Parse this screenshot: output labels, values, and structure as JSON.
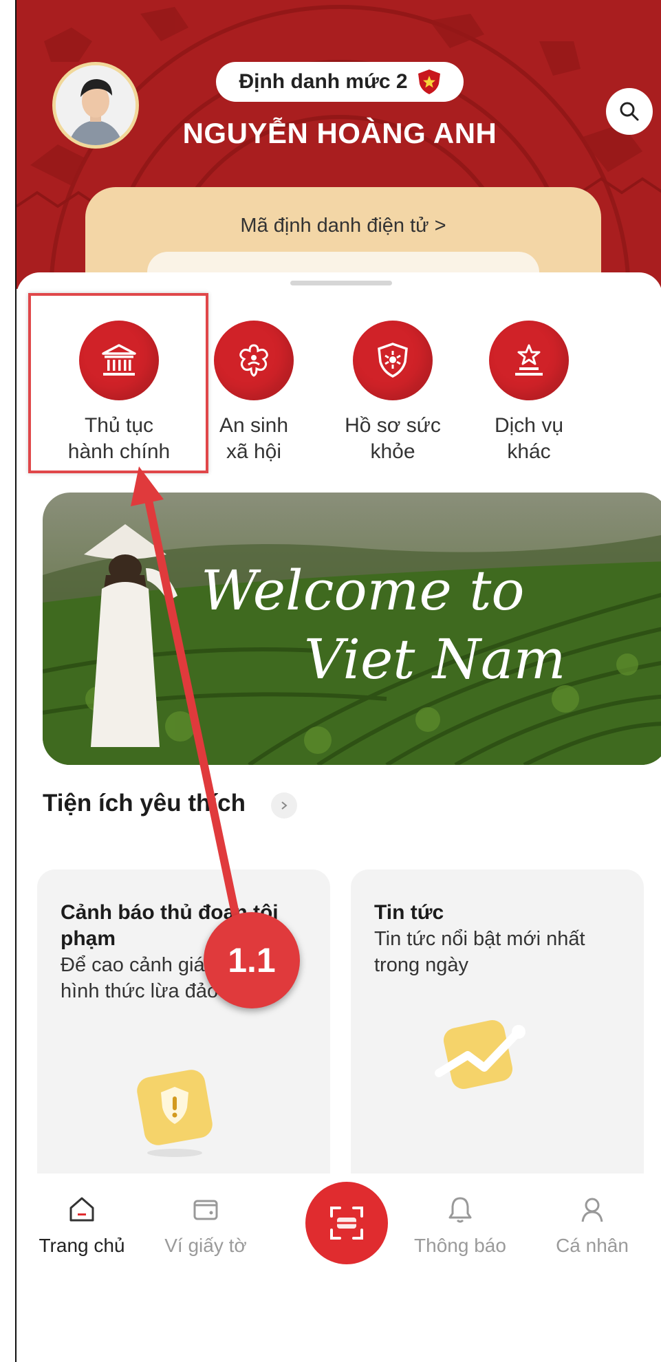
{
  "header": {
    "level_badge": "Định danh mức 2",
    "user_name": "NGUYỄN HOÀNG ANH",
    "id_card_label": "Mã định danh điện tử  >"
  },
  "services": [
    {
      "label_line1": "Thủ tục",
      "label_line2": "hành chính",
      "icon": "bank-icon"
    },
    {
      "label_line1": "An sinh",
      "label_line2": "xã hội",
      "icon": "social-welfare-icon"
    },
    {
      "label_line1": "Hồ sơ sức",
      "label_line2": "khỏe",
      "icon": "health-shield-icon"
    },
    {
      "label_line1": "Dịch vụ",
      "label_line2": "khác",
      "icon": "star-podium-icon"
    }
  ],
  "banner": {
    "line1": "Welcome to",
    "line2": "Viet Nam"
  },
  "annotation": {
    "step": "1.1"
  },
  "favorites": {
    "title": "Tiện ích yêu thích",
    "cards": [
      {
        "title": "Cảnh báo thủ đoạn tội phạm",
        "desc": "Để cao cảnh giác với các hình thức lừa đảo tinh vi",
        "icon": "warning-shield-icon"
      },
      {
        "title": "Tin tức",
        "desc": "Tin tức nổi bật mới nhất trong ngày",
        "icon": "trending-chart-icon"
      }
    ]
  },
  "nav": {
    "home": "Trang chủ",
    "wallet": "Ví giấy tờ",
    "notifications": "Thông báo",
    "profile": "Cá nhân"
  },
  "colors": {
    "primary_red": "#d02228",
    "header_red": "#a91e1f",
    "card_tan": "#f3d6a6"
  }
}
